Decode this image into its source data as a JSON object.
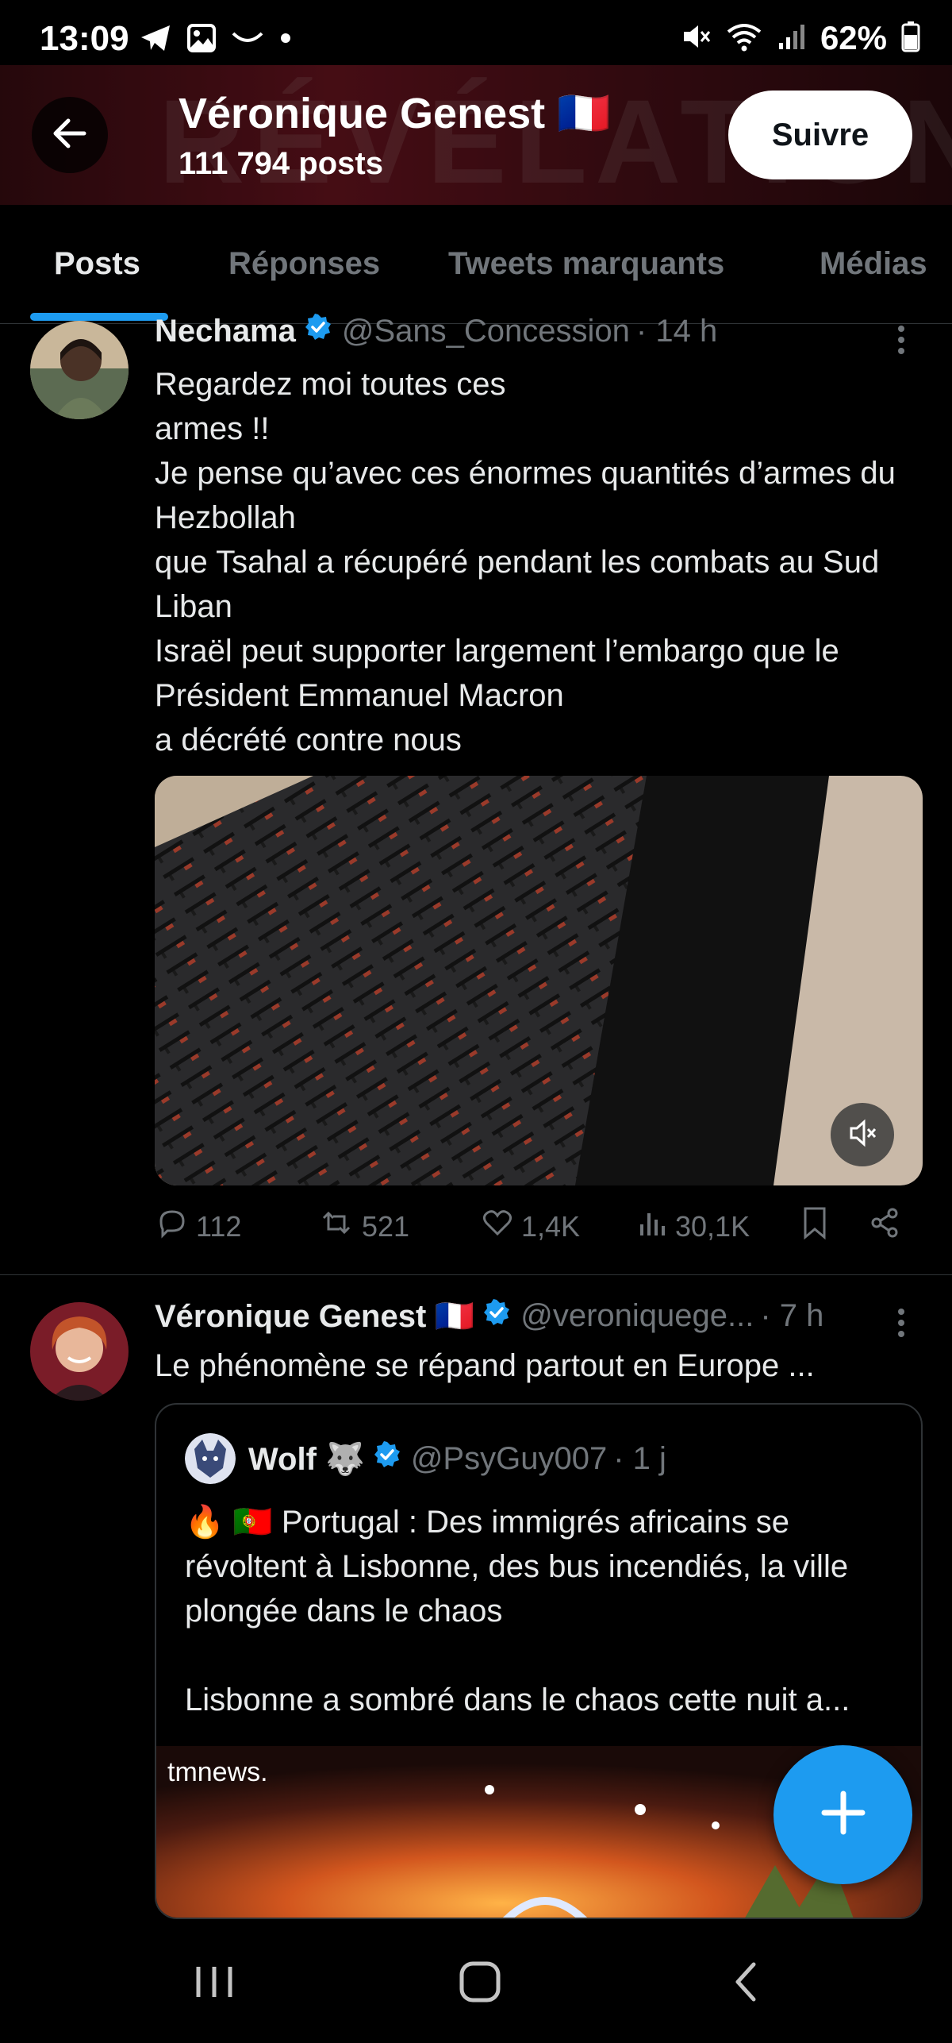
{
  "status_bar": {
    "time": "13:09",
    "battery": "62%",
    "left_icons": [
      "telegram-icon",
      "gallery-icon",
      "smile-icon",
      "dot-icon"
    ],
    "right_icons": [
      "mute-icon",
      "wifi-icon",
      "signal-icon",
      "battery-icon"
    ]
  },
  "header": {
    "name": "Véronique Genest 🇫🇷",
    "post_count": "111 794 posts",
    "banner_text": "RÉVÉLATION",
    "follow_label": "Suivre"
  },
  "tabs": [
    {
      "label": "Posts",
      "active": true
    },
    {
      "label": "Réponses",
      "active": false
    },
    {
      "label": "Tweets marquants",
      "active": false
    },
    {
      "label": "Médias",
      "active": false
    }
  ],
  "tweets": [
    {
      "name": "Nechama",
      "handle": "@Sans_Concession",
      "time": "· 14 h",
      "text": "Regardez moi toutes ces\narmes !!\nJe pense qu’avec ces énormes quantités d’armes du Hezbollah\nque Tsahal a récupéré pendant les combats au Sud Liban\nIsraël peut supporter largement l’embargo que le Président Emmanuel Macron\na décrété contre nous",
      "replies": "112",
      "retweets": "521",
      "likes": "1,4K",
      "views": "30,1K"
    },
    {
      "name": "Véronique Genest 🇫🇷",
      "handle": "@veroniquege...",
      "time": "· 7 h",
      "text": "Le phénomène se répand partout en Europe ...",
      "quote": {
        "name": "Wolf 🐺",
        "handle": "@PsyGuy007",
        "time": "· 1 j",
        "text": "🔥 🇵🇹 Portugal : Des immigrés africains se révoltent à Lisbonne, des bus incendiés, la ville plongée dans le chaos\n\nLisbonne a sombré dans le chaos cette nuit a...",
        "media_logo": "tmnews."
      }
    }
  ],
  "colors": {
    "accent": "#1d9bf0",
    "background": "#000000",
    "text": "#e7e9ea",
    "muted": "#71767b"
  }
}
